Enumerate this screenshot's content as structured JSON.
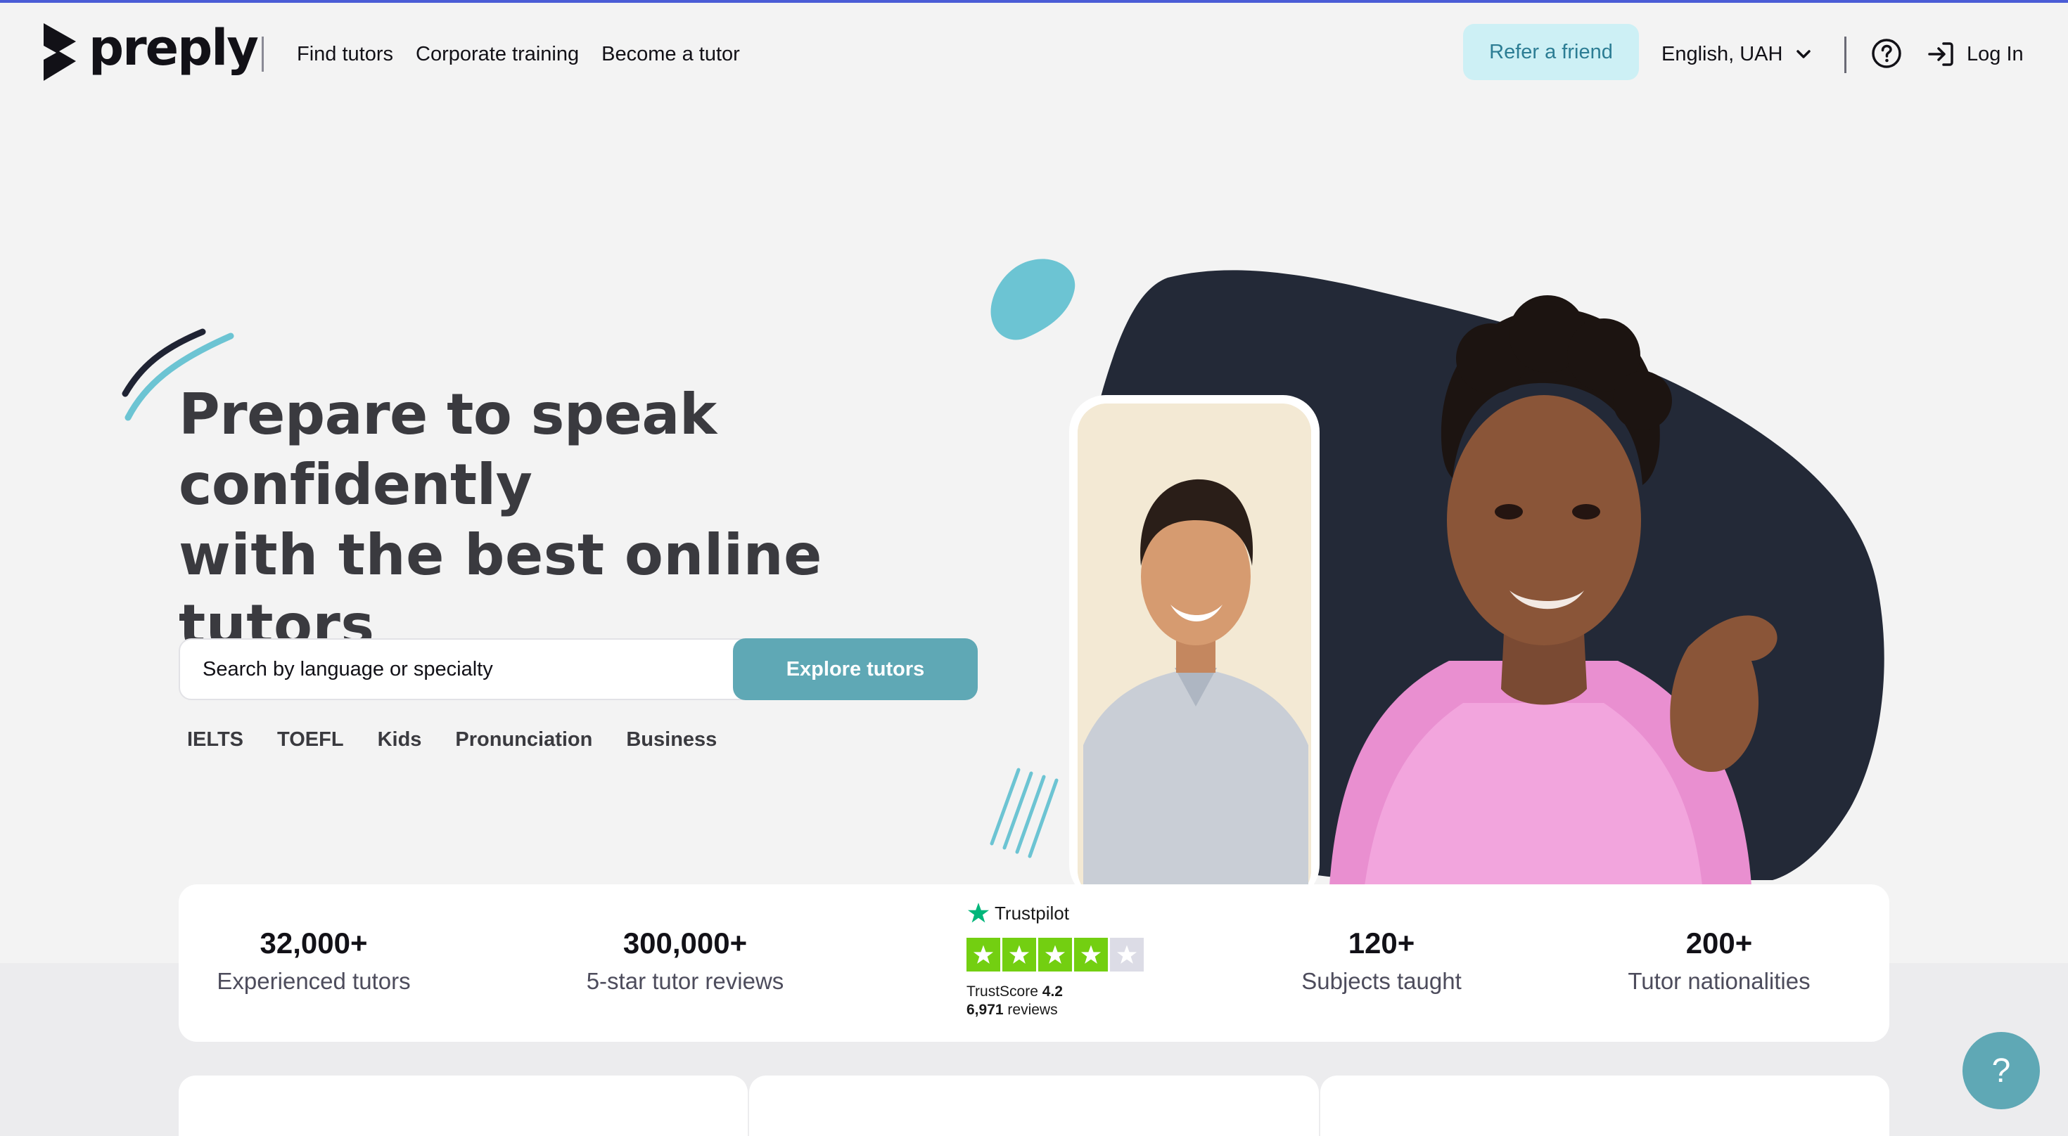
{
  "brand": {
    "name": "preply"
  },
  "nav": {
    "items": [
      {
        "label": "Find tutors"
      },
      {
        "label": "Corporate training"
      },
      {
        "label": "Become a tutor"
      }
    ]
  },
  "header": {
    "refer_label": "Refer a friend",
    "language_label": "English, UAH",
    "login_label": "Log In"
  },
  "hero": {
    "title_line1": "Prepare to speak",
    "title_line2": "confidently",
    "title_line3": "with the best online tutors",
    "search_placeholder": "Search by language or specialty",
    "explore_label": "Explore tutors",
    "tags": [
      "IELTS",
      "TOEFL",
      "Kids",
      "Pronunciation",
      "Business"
    ]
  },
  "stats": [
    {
      "value": "32,000+",
      "label": "Experienced tutors"
    },
    {
      "value": "300,000+",
      "label": "5-star tutor reviews"
    },
    {
      "value": "120+",
      "label": "Subjects taught"
    },
    {
      "value": "200+",
      "label": "Tutor nationalities"
    }
  ],
  "trustpilot": {
    "brand": "Trustpilot",
    "score_label": "TrustScore",
    "score": "4.2",
    "review_count": "6,971",
    "reviews_word": "reviews",
    "stars_filled": 4,
    "stars_total": 5
  },
  "help_fab_label": "?",
  "colors": {
    "accent_teal": "#5fa8b5",
    "refer_bg": "#cdf0f5",
    "blob_dark": "#232937",
    "trustpilot_green": "#00b67a",
    "star_green": "#73cf11"
  },
  "icons": [
    "preply-logo-icon",
    "chevron-down-icon",
    "help-circle-icon",
    "login-icon",
    "trustpilot-star-icon",
    "question-icon"
  ]
}
